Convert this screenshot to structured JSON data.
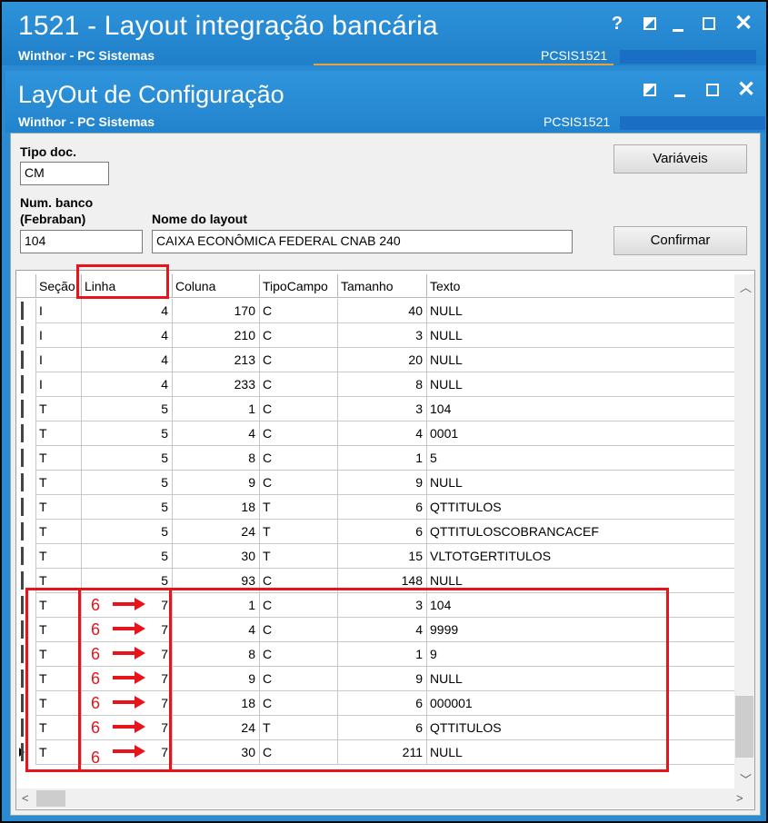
{
  "outer_window": {
    "title": "1521 - Layout integração bancária",
    "company": "Winthor - PC Sistemas",
    "routine": "PCSIS1521",
    "help_label": "?"
  },
  "inner_window": {
    "title": "LayOut de Configuração",
    "company": "Winthor - PC Sistemas",
    "routine": "PCSIS1521"
  },
  "form": {
    "tipo_doc_label": "Tipo doc.",
    "tipo_doc_value": "CM",
    "num_banco_label_1": "Num. banco",
    "num_banco_label_2": "(Febraban)",
    "num_banco_value": "104",
    "nome_layout_label": "Nome do layout",
    "nome_layout_value": "CAIXA ECONÔMICA FEDERAL CNAB 240",
    "variaveis_button": "Variáveis",
    "confirmar_button": "Confirmar"
  },
  "grid": {
    "columns": [
      "Seção",
      "Linha",
      "Coluna",
      "TipoCampo",
      "Tamanho",
      "Texto"
    ],
    "rows": [
      {
        "secao": "I",
        "linha": "4",
        "coluna": "170",
        "tipo": "C",
        "tamanho": "40",
        "texto": "NULL"
      },
      {
        "secao": "I",
        "linha": "4",
        "coluna": "210",
        "tipo": "C",
        "tamanho": "3",
        "texto": "NULL"
      },
      {
        "secao": "I",
        "linha": "4",
        "coluna": "213",
        "tipo": "C",
        "tamanho": "20",
        "texto": "NULL"
      },
      {
        "secao": "I",
        "linha": "4",
        "coluna": "233",
        "tipo": "C",
        "tamanho": "8",
        "texto": "NULL"
      },
      {
        "secao": "T",
        "linha": "5",
        "coluna": "1",
        "tipo": "C",
        "tamanho": "3",
        "texto": "104"
      },
      {
        "secao": "T",
        "linha": "5",
        "coluna": "4",
        "tipo": "C",
        "tamanho": "4",
        "texto": "0001"
      },
      {
        "secao": "T",
        "linha": "5",
        "coluna": "8",
        "tipo": "C",
        "tamanho": "1",
        "texto": "5"
      },
      {
        "secao": "T",
        "linha": "5",
        "coluna": "9",
        "tipo": "C",
        "tamanho": "9",
        "texto": "NULL"
      },
      {
        "secao": "T",
        "linha": "5",
        "coluna": "18",
        "tipo": "T",
        "tamanho": "6",
        "texto": "QTTITULOS"
      },
      {
        "secao": "T",
        "linha": "5",
        "coluna": "24",
        "tipo": "T",
        "tamanho": "6",
        "texto": "QTTITULOSCOBRANCACEF"
      },
      {
        "secao": "T",
        "linha": "5",
        "coluna": "30",
        "tipo": "T",
        "tamanho": "15",
        "texto": "VLTOTGERTITULOS"
      },
      {
        "secao": "T",
        "linha": "5",
        "coluna": "93",
        "tipo": "C",
        "tamanho": "148",
        "texto": "NULL"
      },
      {
        "secao": "T",
        "linha": "7",
        "coluna": "1",
        "tipo": "C",
        "tamanho": "3",
        "texto": "104"
      },
      {
        "secao": "T",
        "linha": "7",
        "coluna": "4",
        "tipo": "C",
        "tamanho": "4",
        "texto": "9999"
      },
      {
        "secao": "T",
        "linha": "7",
        "coluna": "8",
        "tipo": "C",
        "tamanho": "1",
        "texto": "9"
      },
      {
        "secao": "T",
        "linha": "7",
        "coluna": "9",
        "tipo": "C",
        "tamanho": "9",
        "texto": "NULL"
      },
      {
        "secao": "T",
        "linha": "7",
        "coluna": "18",
        "tipo": "C",
        "tamanho": "6",
        "texto": "000001"
      },
      {
        "secao": "T",
        "linha": "7",
        "coluna": "24",
        "tipo": "T",
        "tamanho": "6",
        "texto": "QTTITULOS"
      },
      {
        "secao": "T",
        "linha": "7",
        "coluna": "30",
        "tipo": "C",
        "tamanho": "211",
        "texto": "NULL"
      }
    ],
    "current_row": 18
  },
  "annotations": {
    "old_value": "6",
    "highlight_color": "#e8141c",
    "changed_rows": [
      12,
      13,
      14,
      15,
      16,
      17,
      18
    ]
  },
  "colors": {
    "titlebar": "#2a8bd3",
    "accent_line": "#e8a23a"
  }
}
